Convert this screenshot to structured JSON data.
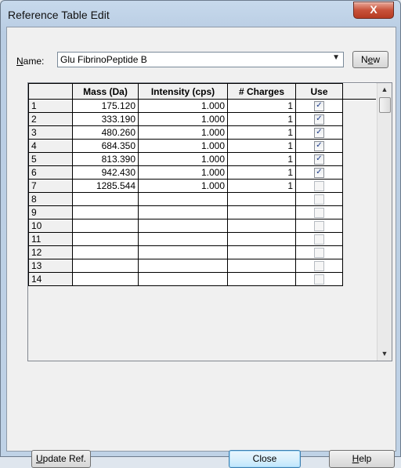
{
  "window": {
    "title": "Reference Table Edit",
    "close_glyph": "X"
  },
  "name_field": {
    "label_prefix": "N",
    "label_rest": "ame:",
    "value": "Glu FibrinoPeptide B",
    "dropdown_glyph": "▼"
  },
  "new_button": {
    "label_prefix": "N",
    "label_u": "e",
    "label_rest": "w"
  },
  "table": {
    "columns": [
      "",
      "Mass (Da)",
      "Intensity (cps)",
      "# Charges",
      "Use"
    ],
    "rows": [
      {
        "n": "1",
        "mass": "175.120",
        "intensity": "1.000",
        "charges": "1",
        "use": true
      },
      {
        "n": "2",
        "mass": "333.190",
        "intensity": "1.000",
        "charges": "1",
        "use": true
      },
      {
        "n": "3",
        "mass": "480.260",
        "intensity": "1.000",
        "charges": "1",
        "use": true
      },
      {
        "n": "4",
        "mass": "684.350",
        "intensity": "1.000",
        "charges": "1",
        "use": true
      },
      {
        "n": "5",
        "mass": "813.390",
        "intensity": "1.000",
        "charges": "1",
        "use": true
      },
      {
        "n": "6",
        "mass": "942.430",
        "intensity": "1.000",
        "charges": "1",
        "use": true
      },
      {
        "n": "7",
        "mass": "1285.544",
        "intensity": "1.000",
        "charges": "1",
        "use": false
      },
      {
        "n": "8",
        "mass": "",
        "intensity": "",
        "charges": "",
        "use": false
      },
      {
        "n": "9",
        "mass": "",
        "intensity": "",
        "charges": "",
        "use": false
      },
      {
        "n": "10",
        "mass": "",
        "intensity": "",
        "charges": "",
        "use": false
      },
      {
        "n": "11",
        "mass": "",
        "intensity": "",
        "charges": "",
        "use": false
      },
      {
        "n": "12",
        "mass": "",
        "intensity": "",
        "charges": "",
        "use": false
      },
      {
        "n": "13",
        "mass": "",
        "intensity": "",
        "charges": "",
        "use": false
      },
      {
        "n": "14",
        "mass": "",
        "intensity": "",
        "charges": "",
        "use": false
      }
    ]
  },
  "scrollbar": {
    "up_glyph": "▲",
    "down_glyph": "▼"
  },
  "buttons": {
    "update_prefix": "U",
    "update_rest": "pdate Ref.",
    "close": "Close",
    "help_prefix": "H",
    "help_rest": "elp"
  },
  "check_glyph": "✓"
}
